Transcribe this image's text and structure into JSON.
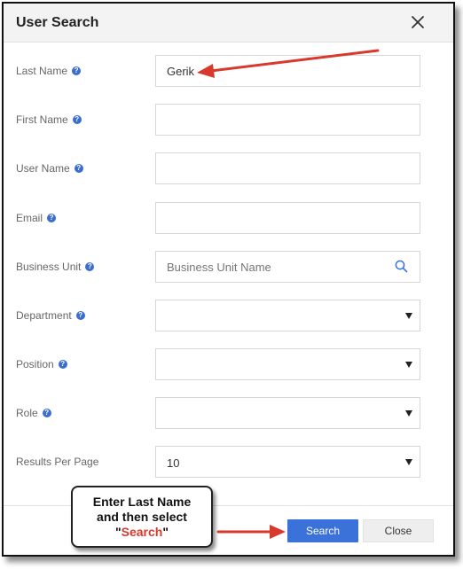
{
  "dialog": {
    "title": "User Search"
  },
  "fields": {
    "last_name": {
      "label": "Last Name",
      "value": "Gerik"
    },
    "first_name": {
      "label": "First Name",
      "value": ""
    },
    "user_name": {
      "label": "User Name",
      "value": ""
    },
    "email": {
      "label": "Email",
      "value": ""
    },
    "business_unit": {
      "label": "Business Unit",
      "placeholder": "Business Unit Name"
    },
    "department": {
      "label": "Department",
      "value": ""
    },
    "position": {
      "label": "Position",
      "value": ""
    },
    "role": {
      "label": "Role",
      "value": ""
    },
    "results_per_page": {
      "label": "Results Per Page",
      "value": "10"
    }
  },
  "help_glyph": "?",
  "buttons": {
    "search": "Search",
    "close": "Close"
  },
  "callout": {
    "line1": "Enter Last Name",
    "line2": "and then select",
    "quote_open": "\"",
    "action": "Search",
    "quote_close": "\""
  },
  "colors": {
    "accent": "#3b72d9",
    "arrow": "#d9382c"
  }
}
